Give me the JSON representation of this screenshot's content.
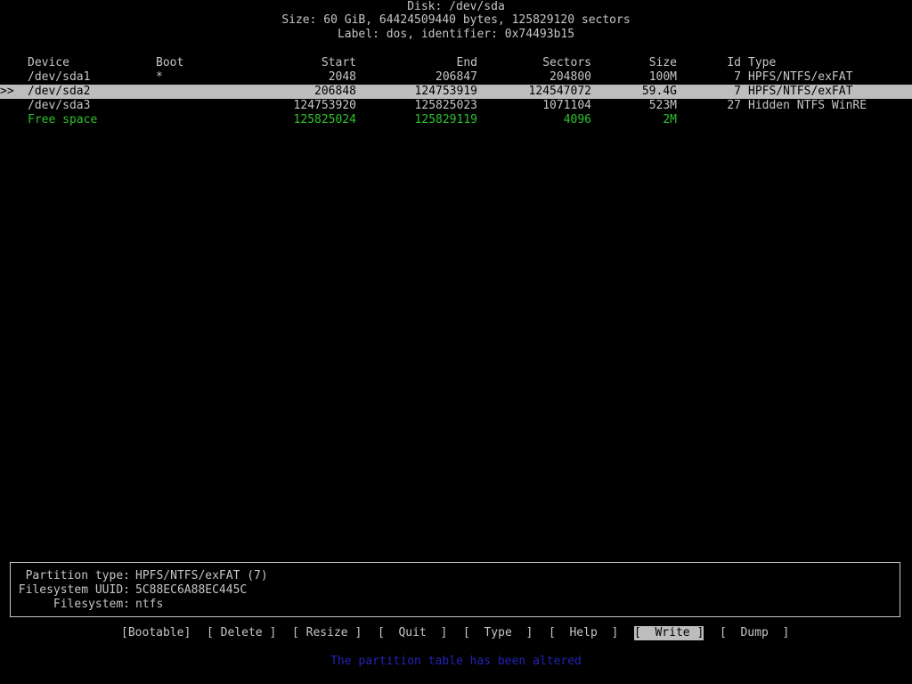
{
  "header": {
    "disk_line": "Disk: /dev/sda",
    "size_line": "Size: 60 GiB, 64424509440 bytes, 125829120 sectors",
    "label_line": "Label: dos, identifier: 0x74493b15"
  },
  "table": {
    "columns": [
      "Device",
      "Boot",
      "Start",
      "End",
      "Sectors",
      "Size",
      "Id",
      "Type"
    ],
    "rows": [
      {
        "device": "/dev/sda1",
        "boot": "*",
        "start": "2048",
        "end": "206847",
        "sectors": "204800",
        "size": "100M",
        "id": "7",
        "type": "HPFS/NTFS/exFAT",
        "selected": false,
        "free": false
      },
      {
        "device": "/dev/sda2",
        "boot": "",
        "start": "206848",
        "end": "124753919",
        "sectors": "124547072",
        "size": "59.4G",
        "id": "7",
        "type": "HPFS/NTFS/exFAT",
        "selected": true,
        "free": false
      },
      {
        "device": "/dev/sda3",
        "boot": "",
        "start": "124753920",
        "end": "125825023",
        "sectors": "1071104",
        "size": "523M",
        "id": "27",
        "type": "Hidden NTFS WinRE",
        "selected": false,
        "free": false
      },
      {
        "device": "Free space",
        "boot": "",
        "start": "125825024",
        "end": "125829119",
        "sectors": "4096",
        "size": "2M",
        "id": "",
        "type": "",
        "selected": false,
        "free": true
      }
    ],
    "cursor_marker": ">>"
  },
  "info": {
    "partition_type_label": "Partition type:",
    "partition_type_value": "HPFS/NTFS/exFAT (7)",
    "uuid_label": "Filesystem UUID:",
    "uuid_value": "5C88EC6A88EC445C",
    "fs_label": "Filesystem:",
    "fs_value": "ntfs"
  },
  "menu": {
    "items": [
      "[Bootable]",
      "[ Delete ]",
      "[ Resize ]",
      "[  Quit  ]",
      "[  Type  ]",
      "[  Help  ]",
      "[  Write ]",
      "[  Dump  ]"
    ],
    "active_index": 6
  },
  "status_message": "The partition table has been altered",
  "colors": {
    "background": "#000000",
    "text": "#c6c6c6",
    "highlight": "#bdbdbd",
    "free_space": "#2fc12f",
    "status": "#2323b8"
  }
}
